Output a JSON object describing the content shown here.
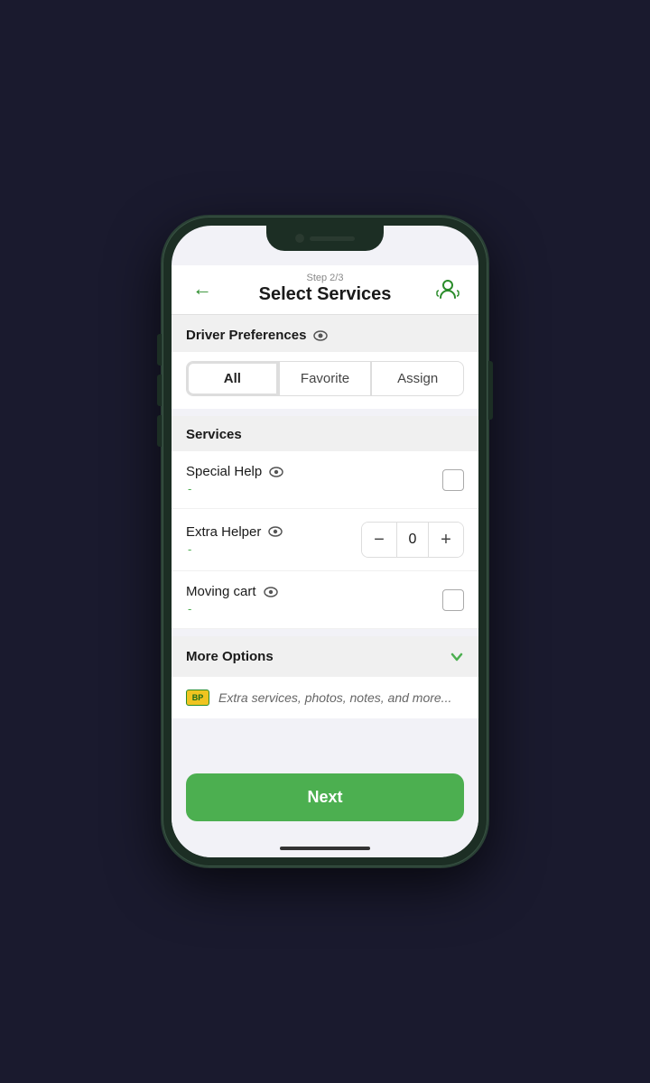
{
  "header": {
    "step_label": "Step 2/3",
    "title": "Select Services",
    "back_label": "←",
    "support_label": "support"
  },
  "driver_preferences": {
    "section_label": "Driver Preferences",
    "tabs": [
      {
        "id": "all",
        "label": "All",
        "active": true
      },
      {
        "id": "favorite",
        "label": "Favorite",
        "active": false
      },
      {
        "id": "assign",
        "label": "Assign",
        "active": false
      }
    ]
  },
  "services": {
    "section_label": "Services",
    "items": [
      {
        "id": "special-help",
        "label": "Special Help",
        "price": "-",
        "type": "checkbox",
        "checked": false
      },
      {
        "id": "extra-helper",
        "label": "Extra Helper",
        "price": "-",
        "type": "counter",
        "value": 0
      },
      {
        "id": "moving-cart",
        "label": "Moving cart",
        "price": "-",
        "type": "checkbox",
        "checked": false
      }
    ]
  },
  "more_options": {
    "section_label": "More Options",
    "description": "Extra services, photos, notes, and more...",
    "badge_text": "BP"
  },
  "footer": {
    "next_label": "Next"
  },
  "icons": {
    "eye": "👁",
    "back_arrow": "←",
    "chevron_down": "✓",
    "support": "🎧"
  }
}
